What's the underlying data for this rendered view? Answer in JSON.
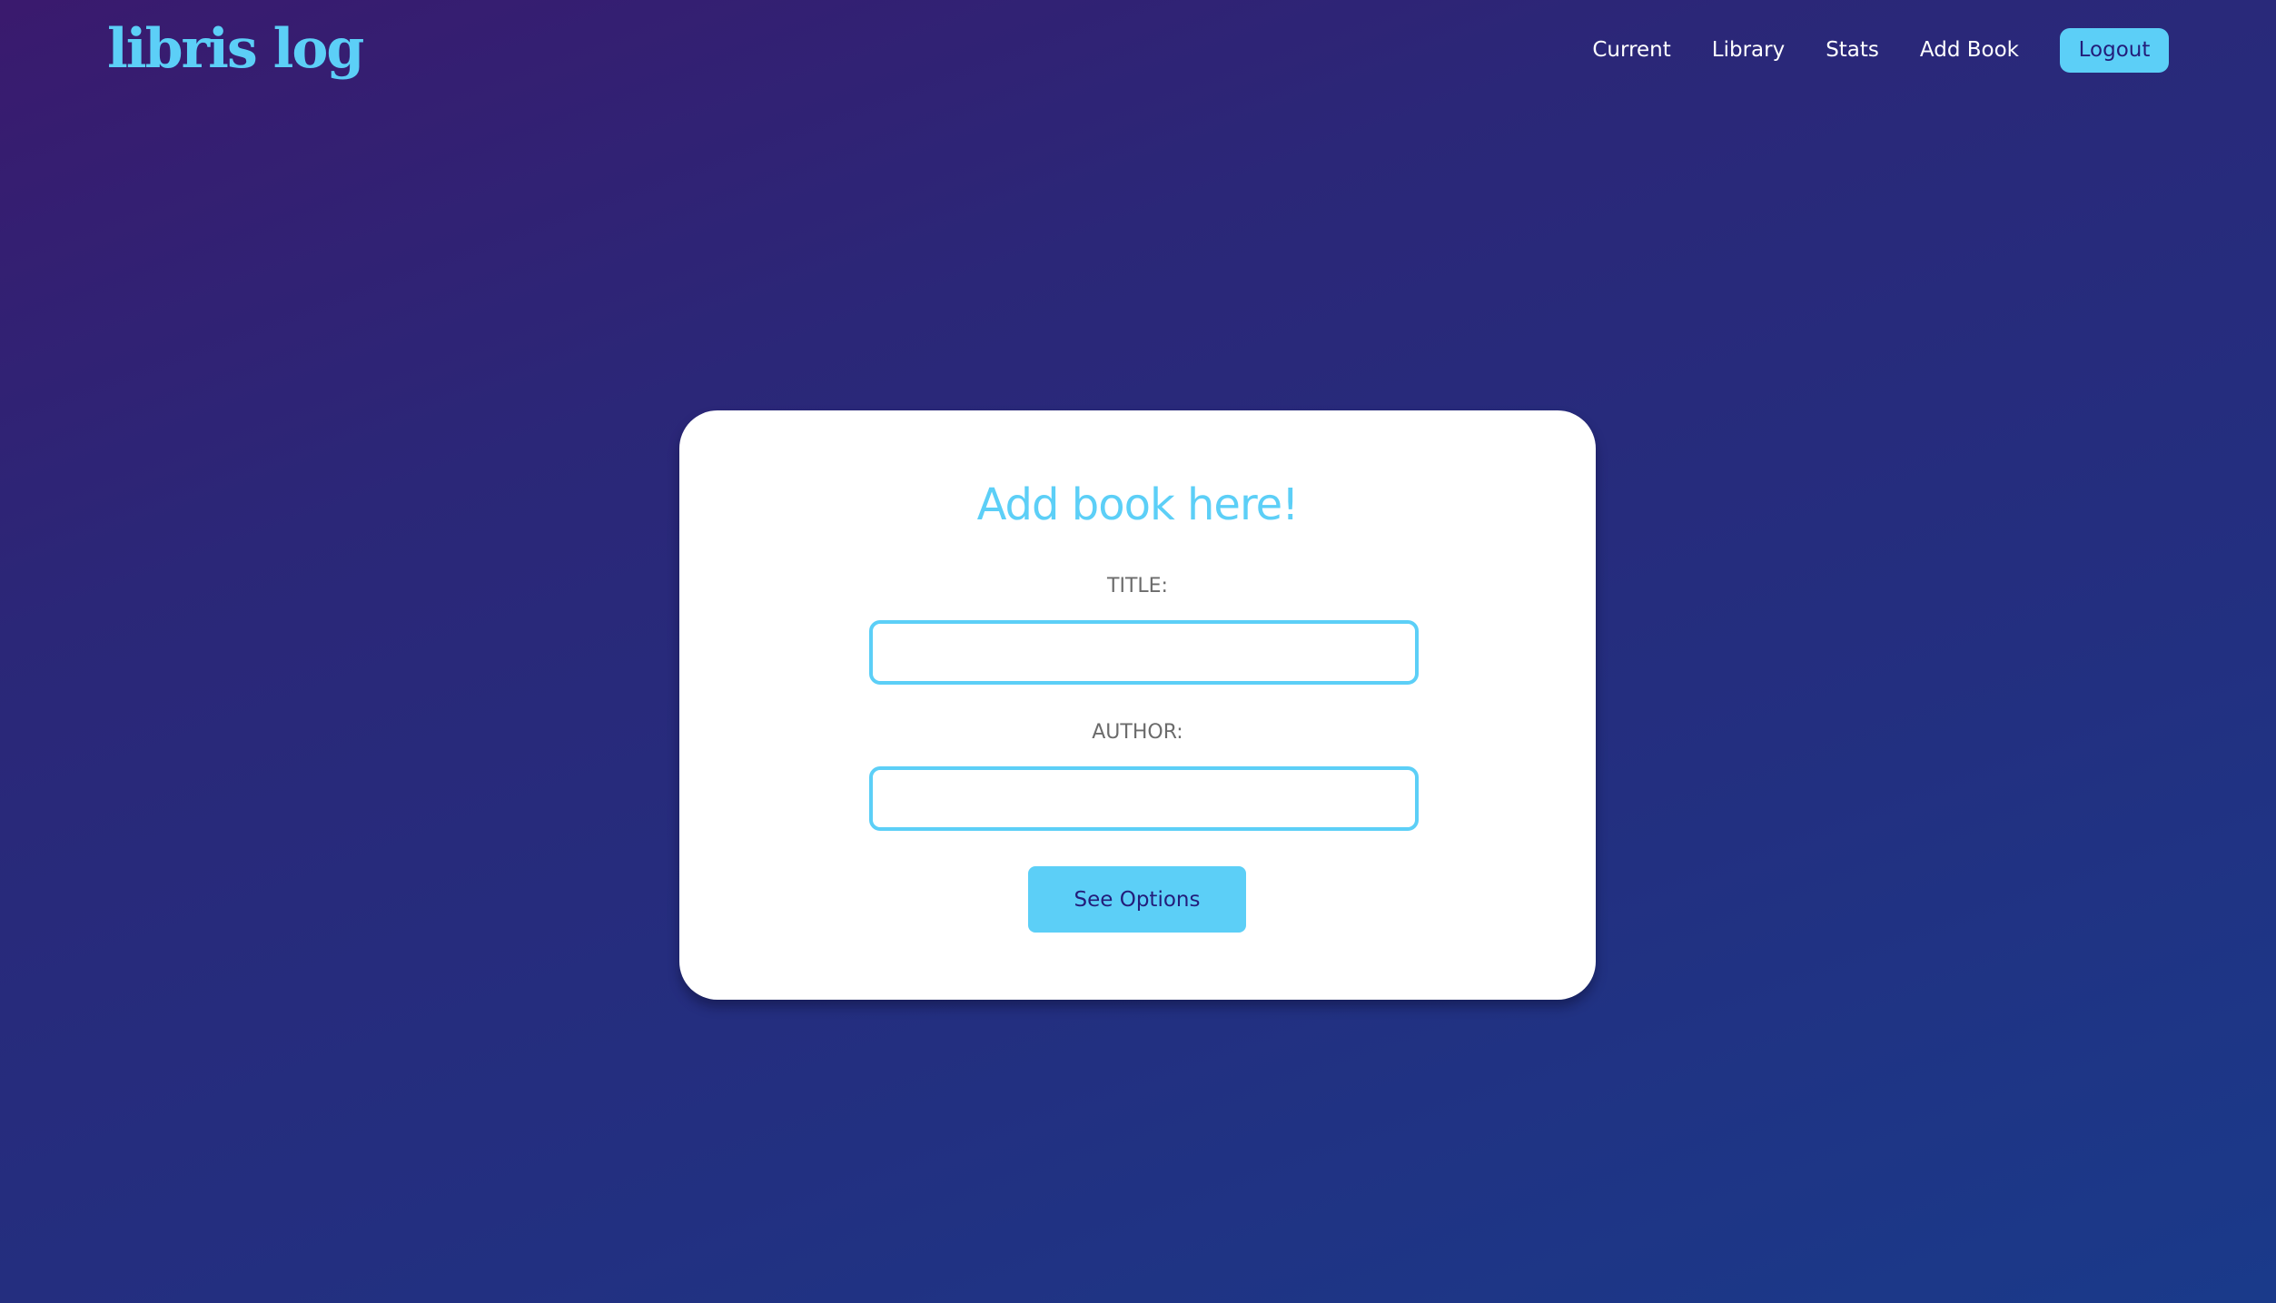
{
  "header": {
    "logo_text": "libris log",
    "nav": {
      "current": "Current",
      "library": "Library",
      "stats": "Stats",
      "add_book": "Add Book"
    },
    "logout_label": "Logout"
  },
  "form": {
    "heading": "Add book here!",
    "title_label": "TITLE:",
    "title_value": "",
    "author_label": "AUTHOR:",
    "author_value": "",
    "submit_label": "See Options"
  },
  "colors": {
    "accent": "#5ccff7",
    "button_text": "#231d7a",
    "label_gray": "#6b6b6b",
    "background_start": "#3a1a6e",
    "background_end": "#1a3a8a",
    "card": "#ffffff"
  }
}
